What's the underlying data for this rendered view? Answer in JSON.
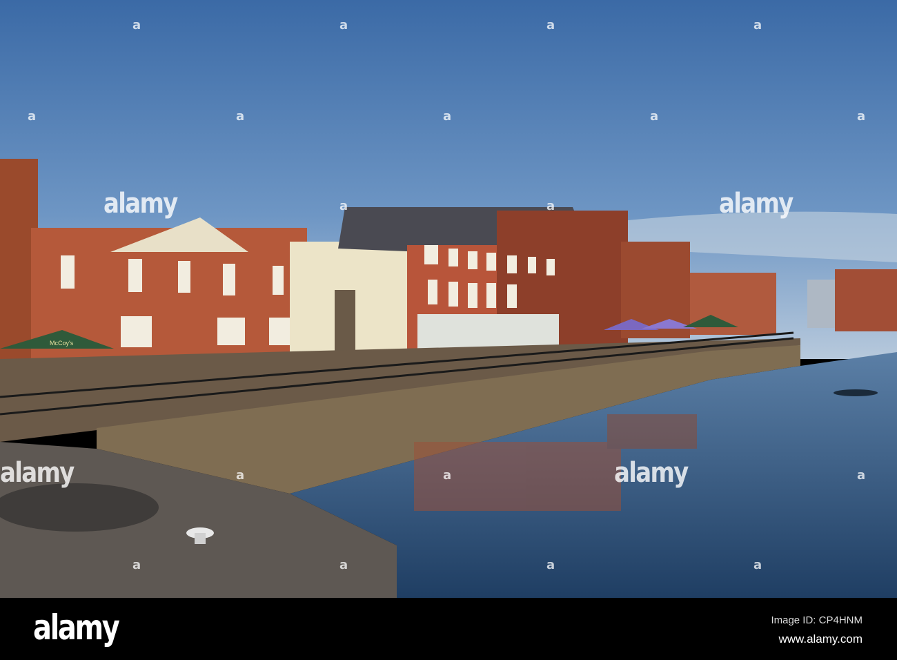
{
  "photo": {
    "watermark_text": "alamy",
    "watermark_mark": "a",
    "umbrella_sign": "McCoy's"
  },
  "footer": {
    "logo": "alamy",
    "image_id": "Image ID: CP4HNM",
    "url": "www.alamy.com"
  }
}
